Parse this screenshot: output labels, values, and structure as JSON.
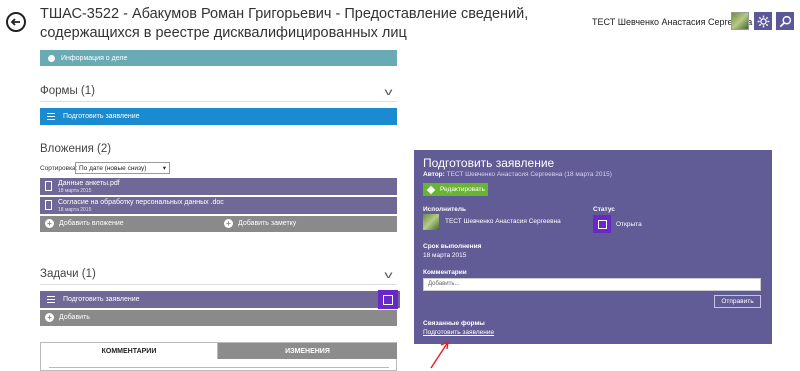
{
  "header": {
    "title": "ТШАС-3522 - Абакумов Роман Григорьевич - Предоставление сведений, содержащихся в реестре дисквалифицированных лиц",
    "user_name": "ТЕСТ Шевченко Анастасия Сергеевна"
  },
  "info_bar": {
    "label": "Информация о деле"
  },
  "forms": {
    "heading": "Формы (1)",
    "item_label": "Подготовить заявление"
  },
  "attachments": {
    "heading": "Вложения (2)",
    "sort_label": "Сортировка:",
    "sort_value": "По дате (новые снизу)",
    "files": [
      {
        "name": "Данные анкеты.pdf",
        "date": "18 марта 2015"
      },
      {
        "name": "Согласие на обработку персональных данных .doc",
        "date": "18 марта 2015"
      }
    ],
    "add_attachment": "Добавить вложение",
    "add_note": "Добавить заметку"
  },
  "tasks": {
    "heading": "Задачи (1)",
    "item_label": "Подготовить заявление",
    "add_label": "Добавить"
  },
  "tabs": {
    "comments": "КОММЕНТАРИИ",
    "changes": "ИЗМЕНЕНИЯ"
  },
  "panel": {
    "title": "Подготовить заявление",
    "author_label": "Автор:",
    "author_value": "ТЕСТ Шевченко Анастасия Сергеевна (18 марта 2015)",
    "edit_label": "Редактировать",
    "executor_label": "Исполнитель",
    "executor_name": "ТЕСТ Шевченко Анастасия Сергеевна",
    "status_label": "Статус",
    "status_value": "Открыта",
    "due_label": "Срок выполнения",
    "due_value": "18 марта 2015",
    "comments_label": "Комментарии",
    "comment_placeholder": "Добавить...",
    "send_label": "Отправить",
    "linked_forms_label": "Связанные формы",
    "linked_form_link": "Подготовить заявление"
  },
  "colors": {
    "panel_bg": "#615b96",
    "info_bar": "#69aab4",
    "forms_bar": "#1a8ad1",
    "list_row": "#706896",
    "gray_bar": "#8a8a8a",
    "status_accent": "#6a28c8",
    "edit_button": "#6ab434",
    "arrow": "#e02020"
  },
  "icons": {
    "back": "back-arrow-icon",
    "settings": "gear-icon",
    "search": "search-icon"
  }
}
